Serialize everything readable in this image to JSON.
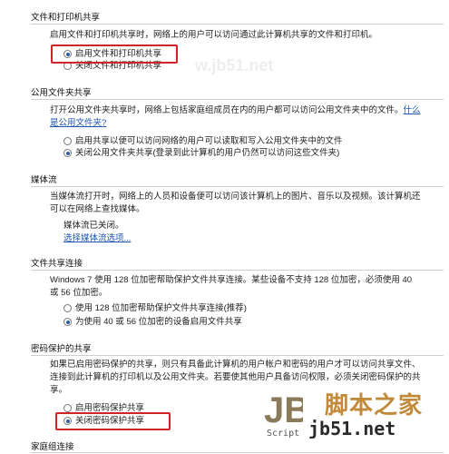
{
  "sections": {
    "file_printer": {
      "title": "文件和打印机共享",
      "description": "启用文件和打印机共享时，网络上的用户可以访问通过此计算机共享的文件和打印机。",
      "options": [
        {
          "label": "启用文件和打印机共享",
          "checked": true
        },
        {
          "label": "关闭文件和打印机共享",
          "checked": false
        }
      ]
    },
    "public_folder": {
      "title": "公用文件夹共享",
      "description_line1": "打开公用文件夹共享时，网络上包括家庭组成员在内的用户都可以访问公用文件夹中的文件。",
      "link_inline": "什么",
      "link_line2": "是公用文件夹?",
      "options": [
        {
          "label": "启用共享以便可以访问网络的用户可以读取和写入公用文件夹中的文件",
          "checked": false
        },
        {
          "label": "关闭公用文件夹共享(登录到此计算机的用户仍然可以访问这些文件夹)",
          "checked": true
        }
      ]
    },
    "media_streaming": {
      "title": "媒体流",
      "description_line1": "当媒体流打开时，网络上的人员和设备便可以访问该计算机上的图片、音乐以及视频。该计算机还",
      "description_line2": "可以在网络上查找媒体。",
      "status": "媒体流已关闭。",
      "link": "选择媒体流选项..."
    },
    "file_sharing_connections": {
      "title": "文件共享连接",
      "description_line1": "Windows 7 使用 128 位加密帮助保护文件共享连接。某些设备不支持 128 位加密，必须使用 40",
      "description_line2": "或 56 位加密。",
      "options": [
        {
          "label": "使用 128 位加密帮助保护文件共享连接(推荐)",
          "checked": false
        },
        {
          "label": "为使用 40 或 56 位加密的设备启用文件共享",
          "checked": true
        }
      ]
    },
    "password_sharing": {
      "title": "密码保护的共享",
      "description_line1": "如果已启用密码保护的共享，则只有具备此计算机的用户帐户和密码的用户才可以访问共享文件、",
      "description_line2": "连接到此计算机的打印机以及公用文件夹。若要使其他用户具备访问权限，必须关闭密码保护的共",
      "description_line3": "享。",
      "options": [
        {
          "label": "启用密码保护共享",
          "checked": false
        },
        {
          "label": "关闭密码保护共享",
          "checked": true
        }
      ]
    },
    "homegroup": {
      "title": "家庭组连接"
    }
  },
  "watermark": {
    "logo_letters": "JB",
    "script_text": "Script",
    "site_cn": "脚本之家",
    "site_url": "jb51.net"
  },
  "colors": {
    "highlight": "#d2222a",
    "link": "#1f56b0",
    "radio_dot": "#2f5c9e",
    "divider": "#cfcfcf"
  }
}
